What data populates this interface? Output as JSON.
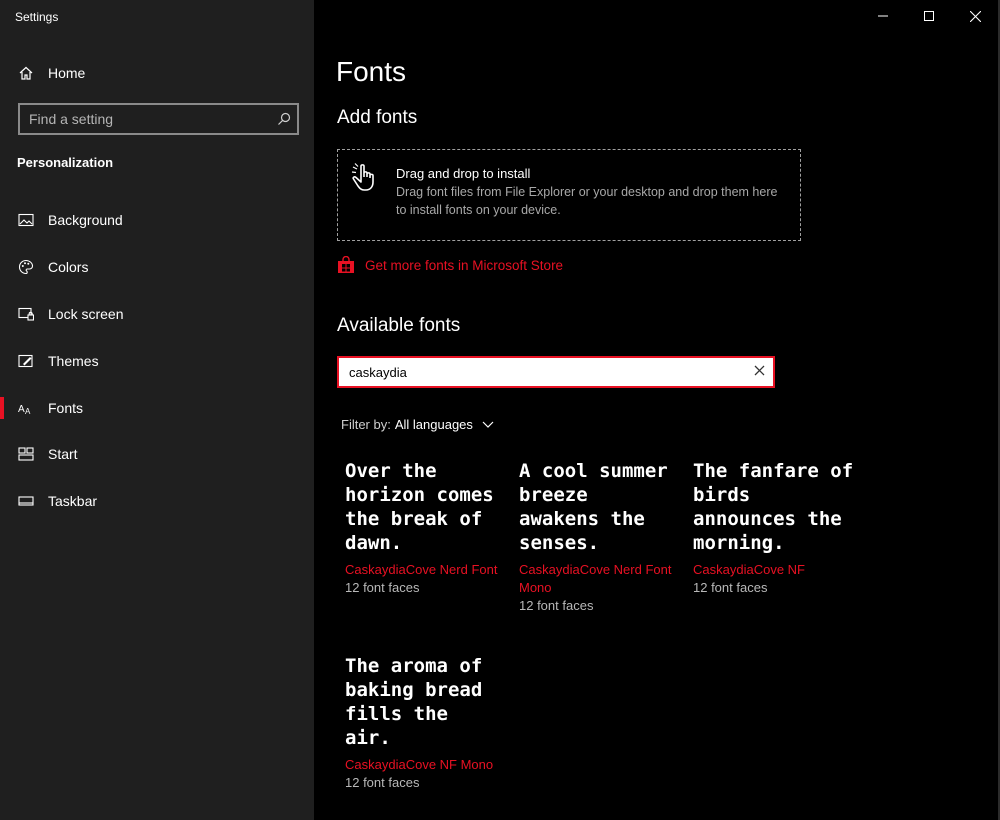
{
  "window": {
    "title": "Settings"
  },
  "sidebar": {
    "home_label": "Home",
    "search_placeholder": "Find a setting",
    "section_label": "Personalization",
    "items": [
      {
        "label": "Background",
        "icon": "image-icon"
      },
      {
        "label": "Colors",
        "icon": "palette-icon"
      },
      {
        "label": "Lock screen",
        "icon": "lock-screen-icon"
      },
      {
        "label": "Themes",
        "icon": "themes-icon"
      },
      {
        "label": "Fonts",
        "icon": "fonts-icon",
        "active": true
      },
      {
        "label": "Start",
        "icon": "start-icon"
      },
      {
        "label": "Taskbar",
        "icon": "taskbar-icon"
      }
    ]
  },
  "main": {
    "title": "Fonts",
    "add_fonts": {
      "heading": "Add fonts",
      "drop_title": "Drag and drop to install",
      "drop_desc": "Drag font files from File Explorer or your desktop and drop them here to install fonts on your device."
    },
    "store_link": "Get more fonts in Microsoft Store",
    "available": {
      "heading": "Available fonts",
      "search_value": "caskaydia",
      "filter_label": "Filter by:",
      "filter_value": "All languages"
    },
    "fonts": [
      {
        "preview": "Over the horizon comes the break of dawn.",
        "name": "CaskaydiaCove Nerd Font",
        "faces": "12 font faces"
      },
      {
        "preview": "A cool summer breeze awakens the senses.",
        "name": "CaskaydiaCove Nerd Font Mono",
        "faces": "12 font faces"
      },
      {
        "preview": "The fanfare of birds announces the morning.",
        "name": "CaskaydiaCove NF",
        "faces": "12 font faces"
      },
      {
        "preview": "The aroma of baking bread fills the air.",
        "name": "CaskaydiaCove NF Mono",
        "faces": "12 font faces"
      }
    ]
  },
  "colors": {
    "accent": "#e81123",
    "sidebar_bg": "#1f1f1f",
    "main_bg": "#000000"
  }
}
